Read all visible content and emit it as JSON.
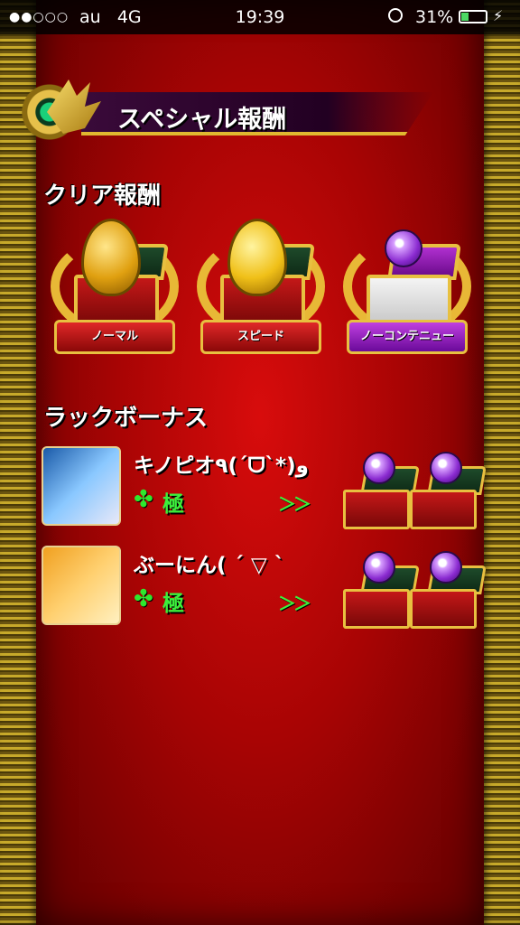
{
  "status_bar": {
    "signal": "●●○○○",
    "carrier": "au",
    "network": "4G",
    "time": "19:39",
    "battery_pct": "31%",
    "battery_level": 0.31
  },
  "banner": {
    "title": "スペシャル報酬"
  },
  "clear_rewards": {
    "heading": "クリア報酬",
    "items": [
      {
        "label": "ノーマル",
        "reward": "honey-egg-icon"
      },
      {
        "label": "スピード",
        "reward": "gold-egg-icon"
      },
      {
        "label": "ノーコンテニュー",
        "reward": "orb-chest-icon"
      }
    ]
  },
  "luck_bonus": {
    "heading": "ラックボーナス",
    "rows": [
      {
        "name": "キノピオ٩(ˊᗜˋ*)و",
        "rank": "極",
        "clover": "✤",
        "arrows": "＞＞"
      },
      {
        "name": "ぶーにん( ´ ▽ ` ",
        "rank": "極",
        "clover": "✤",
        "arrows": "＞＞"
      }
    ]
  },
  "colors": {
    "panel_red": "#c00808",
    "gold": "#e8c040",
    "luck_green": "#3cf03c"
  }
}
